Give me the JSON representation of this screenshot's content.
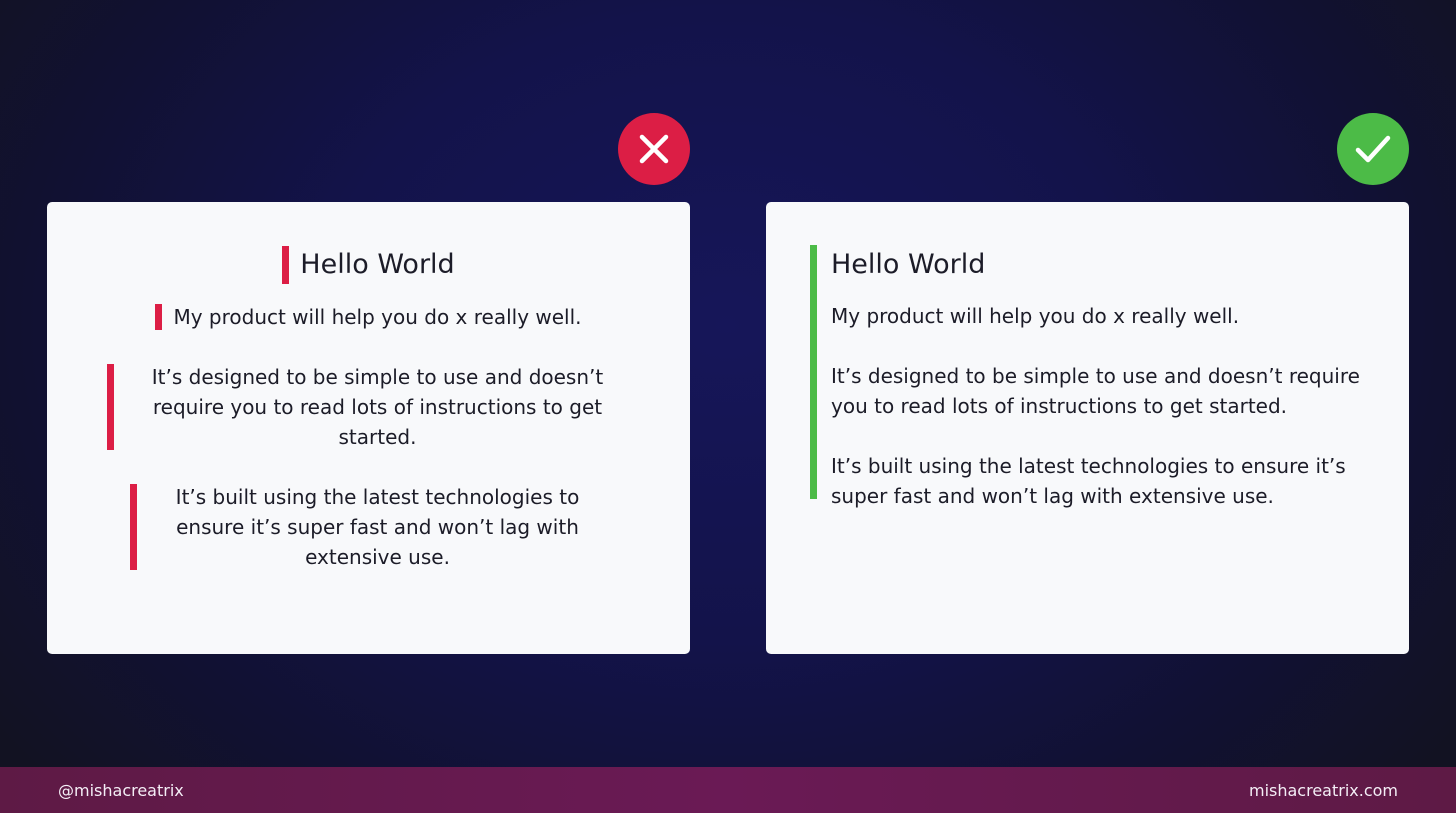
{
  "colors": {
    "bad": "#dc1e45",
    "good": "#4cbb47"
  },
  "icons": {
    "bad": "close-icon",
    "good": "check-icon"
  },
  "bad_card": {
    "title": "Hello World",
    "paragraphs": [
      "My product will help you do x really well.",
      "It’s designed to be simple to use and doesn’t require you to read lots of instructions to get started.",
      "It’s built using the latest technologies to ensure it’s super fast and won’t lag with extensive use."
    ]
  },
  "good_card": {
    "title": "Hello World",
    "paragraphs": [
      "My product will help you do x really well.",
      "It’s designed to be simple to use and doesn’t require you to read lots of instructions to get started.",
      "It’s built using the latest technologies to ensure it’s super fast and won’t lag with extensive use."
    ]
  },
  "footer": {
    "handle": "@mishacreatrix",
    "website": "mishacreatrix.com"
  }
}
